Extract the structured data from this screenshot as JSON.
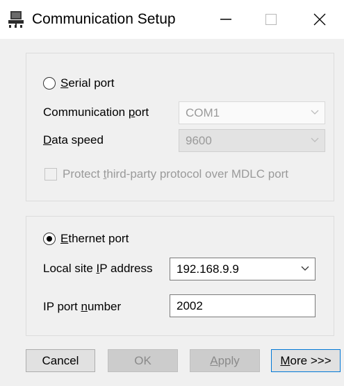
{
  "window": {
    "title": "Communication Setup",
    "icon": "network-plug-icon",
    "controls": [
      "minimize-icon",
      "maximize-icon",
      "close-icon"
    ]
  },
  "serial": {
    "radio_prefix": "",
    "radio_accel": "S",
    "radio_rest": "erial port",
    "selected": false,
    "comm_port_label_pre": "Communication ",
    "comm_port_label_accel": "p",
    "comm_port_label_post": "ort",
    "comm_port_value": "COM1",
    "data_speed_label_accel": "D",
    "data_speed_label_post": "ata speed",
    "data_speed_value": "9600",
    "protect_pre": "Protect ",
    "protect_accel": "t",
    "protect_post": "hird-party protocol over MDLC port",
    "protect_checked": false
  },
  "ethernet": {
    "radio_accel": "E",
    "radio_rest": "thernet port",
    "selected": true,
    "ip_label_pre": "Local site ",
    "ip_label_accel": "I",
    "ip_label_post": "P address",
    "ip_value": "192.168.9.9",
    "port_label_pre": "IP port ",
    "port_label_accel": "n",
    "port_label_post": "umber",
    "port_value": "2002"
  },
  "buttons": {
    "cancel": "Cancel",
    "ok": "OK",
    "apply_accel": "A",
    "apply_post": "pply",
    "more_accel": "M",
    "more_post": "ore >>>"
  }
}
